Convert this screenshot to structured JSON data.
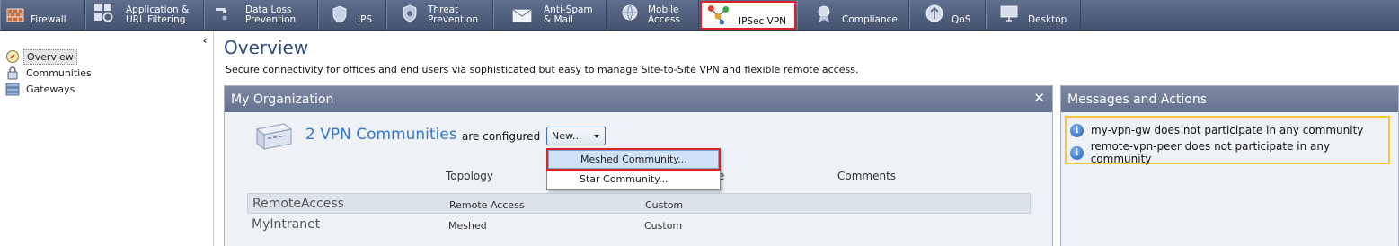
{
  "tabs": [
    {
      "label": "Firewall",
      "icon": "firewall-icon"
    },
    {
      "label": "Application &\nURL Filtering",
      "icon": "app-filtering-icon"
    },
    {
      "label": "Data Loss\nPrevention",
      "icon": "data-loss-icon"
    },
    {
      "label": "IPS",
      "icon": "shield-icon"
    },
    {
      "label": "Threat\nPrevention",
      "icon": "threat-prevention-icon"
    },
    {
      "label": "Anti-Spam\n& Mail",
      "icon": "mail-icon"
    },
    {
      "label": "Mobile\nAccess",
      "icon": "mobile-access-icon"
    },
    {
      "label": "IPSec VPN",
      "icon": "vpn-network-icon",
      "active": true
    },
    {
      "label": "Compliance",
      "icon": "compliance-icon"
    },
    {
      "label": "QoS",
      "icon": "qos-icon"
    },
    {
      "label": "Desktop",
      "icon": "desktop-icon"
    }
  ],
  "sidebar": {
    "items": [
      {
        "label": "Overview",
        "icon": "compass-icon",
        "selected": true
      },
      {
        "label": "Communities",
        "icon": "lock-icon"
      },
      {
        "label": "Gateways",
        "icon": "gateways-icon"
      }
    ]
  },
  "main": {
    "title": "Overview",
    "description": "Secure connectivity for offices and end users via sophisticated but easy to manage Site-to-Site VPN and flexible remote access."
  },
  "org_panel": {
    "title": "My Organization",
    "community_count": "2 VPN Communities",
    "configured_text": "are configured",
    "new_button": "New...",
    "columns": {
      "topology": "Topology",
      "type_suffix": "e",
      "comments": "Comments"
    },
    "rows": [
      {
        "name": "RemoteAccess",
        "topology": "Remote Access",
        "type": "Custom"
      },
      {
        "name": "MyIntranet",
        "topology": "Meshed",
        "type": "Custom"
      }
    ],
    "dropdown": [
      {
        "label": "Meshed Community..."
      },
      {
        "label": "Star Community..."
      }
    ]
  },
  "messages_panel": {
    "title": "Messages and Actions",
    "messages": [
      "my-vpn-gw does not participate in any community",
      "remote-vpn-peer does not participate in any community"
    ]
  },
  "colors": {
    "highlight_red": "#d9232a",
    "warning_yellow": "#f2c53d",
    "link_blue": "#3a78c6"
  }
}
